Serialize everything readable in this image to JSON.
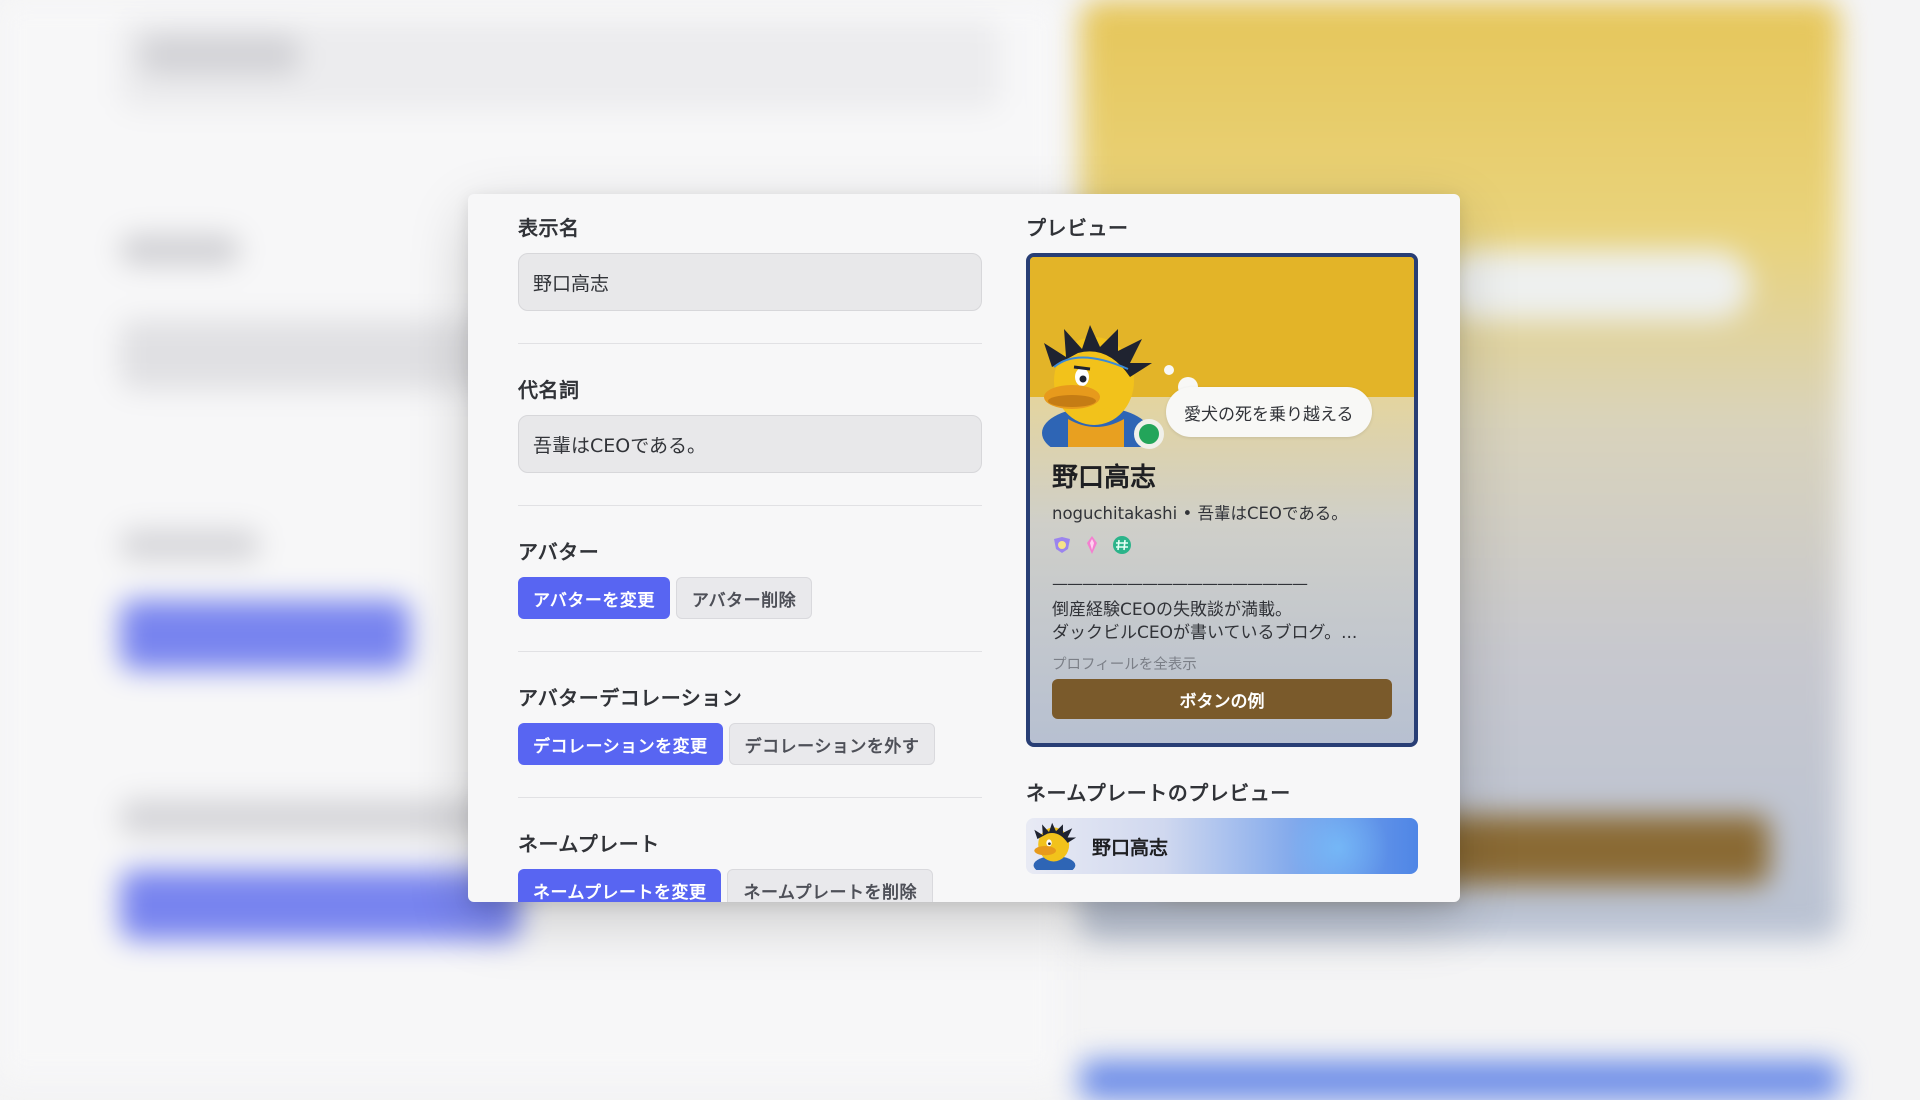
{
  "form": {
    "display_name": {
      "label": "表示名",
      "value": "野口高志"
    },
    "pronouns": {
      "label": "代名詞",
      "value": "吾輩はCEOである。"
    },
    "avatar": {
      "label": "アバター",
      "change": "アバターを変更",
      "remove": "アバター削除"
    },
    "decoration": {
      "label": "アバターデコレーション",
      "change": "デコレーションを変更",
      "remove": "デコレーションを外す"
    },
    "nameplate": {
      "label": "ネームプレート",
      "change": "ネームプレートを変更",
      "remove": "ネームプレートを削除"
    }
  },
  "preview": {
    "label": "プレビュー",
    "status": "愛犬の死を乗り越える",
    "name": "野口高志",
    "username": "noguchitakashi",
    "pronouns": "吾輩はCEOである。",
    "separator": "•",
    "badges": [
      "hypesquad-icon",
      "nitro-gem-icon",
      "hash-icon"
    ],
    "bio_rule": "—————————————————",
    "bio_line1": "倒産経験CEOの失敗談が満載。",
    "bio_line2": "ダックビルCEOが書いているブログ。...",
    "view_full": "プロフィールを全表示",
    "example_button": "ボタンの例"
  },
  "nameplate_preview": {
    "label": "ネームプレートのプレビュー",
    "name": "野口高志"
  },
  "colors": {
    "primary": "#5865f2",
    "banner": "#e3b428",
    "card_border": "#283e75",
    "example_button": "#7a5a2b",
    "online": "#23a55a"
  }
}
